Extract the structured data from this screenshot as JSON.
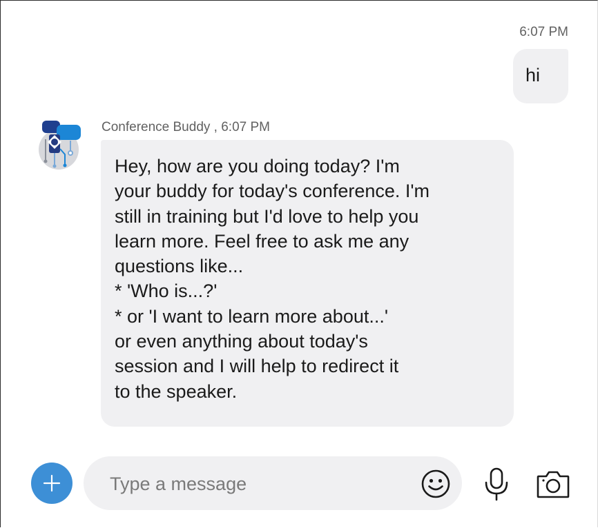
{
  "outgoing": {
    "time": "6:07 PM",
    "text": "hi"
  },
  "bot": {
    "sender": "Conference Buddy",
    "time": "6:07 PM",
    "meta": "Conference Buddy , 6:07 PM",
    "avatar_icon": "conference-buddy-avatar-icon",
    "message": "Hey, how are you doing today? I'm\nyour buddy for today's conference. I'm\nstill in training but I'd love to help you\nlearn more. Feel free to ask me any\nquestions like...\n* 'Who is...?'\n* or 'I want to learn more about...'\nor even anything about today's\nsession and I will help to redirect it\nto the speaker."
  },
  "composer": {
    "placeholder": "Type a message",
    "add_icon": "plus-icon",
    "emoji_icon": "smiley-icon",
    "mic_icon": "microphone-icon",
    "camera_icon": "camera-icon"
  },
  "colors": {
    "accent": "#3d8fd6",
    "bubble": "#f0f0f2",
    "meta_text": "#616161"
  }
}
